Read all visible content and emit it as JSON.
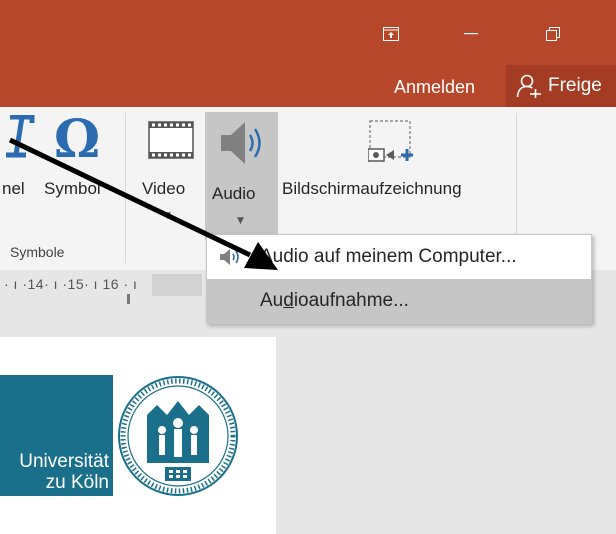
{
  "titlebar": {
    "signin_label": "Anmelden",
    "share_label": "Freige",
    "bg_color": "#b7472a"
  },
  "ribbon": {
    "items": [
      {
        "label": "nel",
        "icon": "equation-icon"
      },
      {
        "label": "Symbol",
        "icon": "omega-symbol-icon"
      },
      {
        "label": "Video",
        "icon": "film-strip-icon"
      },
      {
        "label": "Audio",
        "icon": "speaker-icon"
      },
      {
        "label": "Bildschirmaufzeichnung",
        "icon": "screen-recording-icon"
      }
    ],
    "group_label": "Symbole"
  },
  "ruler": {
    "text": "· ı ·14· ı ·15· ı  16 · ı"
  },
  "menu": {
    "items": [
      {
        "label": "Audio auf meinem Computer...",
        "icon": "speaker-small-icon"
      },
      {
        "label_pre": "Au",
        "label_accel": "d",
        "label_post": "ioaufnahme...",
        "highlighted": true
      }
    ]
  },
  "slide": {
    "logo_line1": "Universität",
    "logo_line2": "zu Köln",
    "logo_color": "#1a6f8a"
  }
}
